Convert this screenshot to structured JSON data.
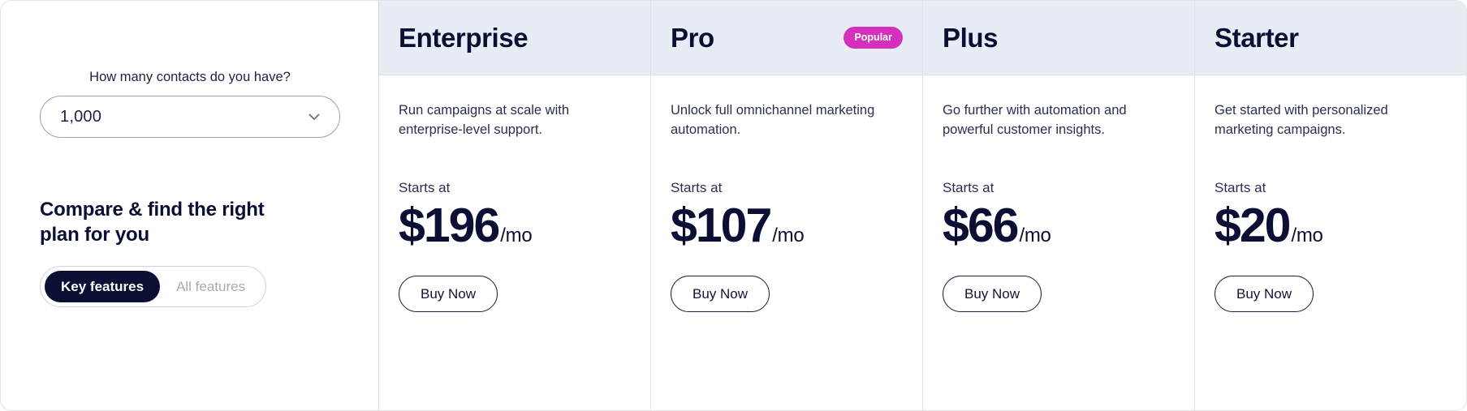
{
  "selector_panel": {
    "contacts_question": "How many contacts do you have?",
    "contacts_value": "1,000",
    "contacts_icon": "chevron-down-icon",
    "compare_heading": "Compare & find the right plan for you",
    "toggle": {
      "key_features_label": "Key features",
      "all_features_label": "All features",
      "active": "Key features"
    }
  },
  "colors": {
    "header_band": "#e8ecf5",
    "popular_badge": "#d430bd",
    "text_primary": "#0b0f33",
    "toggle_active_bg": "#0b0f33"
  },
  "plans": [
    {
      "name": "Enterprise",
      "badge": "",
      "description": "Run campaigns at scale with enterprise-level support.",
      "starts_at_label": "Starts at",
      "price": "$196",
      "period": "/mo",
      "cta_label": "Buy Now"
    },
    {
      "name": "Pro",
      "badge": "Popular",
      "description": "Unlock full omnichannel marketing automation.",
      "starts_at_label": "Starts at",
      "price": "$107",
      "period": "/mo",
      "cta_label": "Buy Now"
    },
    {
      "name": "Plus",
      "badge": "",
      "description": "Go further with automation and powerful customer insights.",
      "starts_at_label": "Starts at",
      "price": "$66",
      "period": "/mo",
      "cta_label": "Buy Now"
    },
    {
      "name": "Starter",
      "badge": "",
      "description": "Get started with personalized marketing campaigns.",
      "starts_at_label": "Starts at",
      "price": "$20",
      "period": "/mo",
      "cta_label": "Buy Now"
    }
  ]
}
